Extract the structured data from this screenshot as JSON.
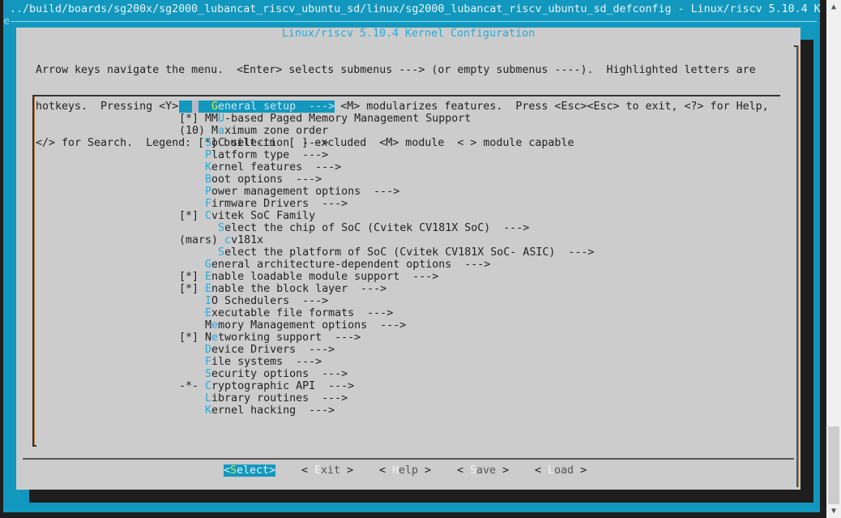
{
  "terminal": {
    "title_line": "../build/boards/sg200x/sg2000_lubancat_riscv_ubuntu_sd/linux/sg2000_lubancat_riscv_ubuntu_sd_defconfig - Linux/riscv 5.10.4 K",
    "second_line_char": "e"
  },
  "dialog": {
    "title": "Linux/riscv 5.10.4 Kernel Configuration",
    "help_lines": [
      "Arrow keys navigate the menu.  <Enter> selects submenus ---> (or empty submenus ----).  Highlighted letters are",
      "hotkeys.  Pressing <Y> includes, <N> excludes, <M> modularizes features.  Press <Esc><Esc> to exit, <?> for Help,",
      "</> for Search.  Legend: [*] built-in  [ ] excluded  <M> module  < > module capable"
    ]
  },
  "menu": {
    "items": [
      {
        "prefix": "    ",
        "hotkey": "G",
        "rest": "eneral setup  --->",
        "selected": true
      },
      {
        "prefix": "[*] ",
        "pre": "MM",
        "hotkey": "U",
        "rest": "-based Paged Memory Management Support"
      },
      {
        "prefix": "(10) ",
        "pre": "M",
        "hotkey": "a",
        "rest": "ximum zone order"
      },
      {
        "prefix": "    ",
        "hotkey": "S",
        "rest": "oC selection  --->"
      },
      {
        "prefix": "    ",
        "hotkey": "P",
        "rest": "latform type  --->"
      },
      {
        "prefix": "    ",
        "hotkey": "K",
        "rest": "ernel features  --->"
      },
      {
        "prefix": "    ",
        "hotkey": "B",
        "rest": "oot options  --->"
      },
      {
        "prefix": "    ",
        "hotkey": "P",
        "rest": "ower management options  --->"
      },
      {
        "prefix": "    ",
        "hotkey": "F",
        "rest": "irmware Drivers  --->"
      },
      {
        "prefix": "[*] ",
        "hotkey": "C",
        "rest": "vitek SoC Family"
      },
      {
        "prefix": "      ",
        "hotkey": "S",
        "rest": "elect the chip of SoC (Cvitek CV181X SoC)  --->"
      },
      {
        "prefix": "(mars) ",
        "hotkey": "c",
        "rest": "v181x"
      },
      {
        "prefix": "      ",
        "hotkey": "S",
        "rest": "elect the platform of SoC (Cvitek CV181X SoC- ASIC)  --->"
      },
      {
        "prefix": "    ",
        "hotkey": "G",
        "rest": "eneral architecture-dependent options  --->"
      },
      {
        "prefix": "[*] ",
        "hotkey": "E",
        "rest": "nable loadable module support  --->"
      },
      {
        "prefix": "[*] ",
        "hotkey": "E",
        "rest": "nable the block layer  --->"
      },
      {
        "prefix": "    ",
        "hotkey": "I",
        "rest": "O Schedulers  --->"
      },
      {
        "prefix": "    ",
        "hotkey": "E",
        "rest": "xecutable file formats  --->"
      },
      {
        "prefix": "    ",
        "pre": "M",
        "hotkey": "e",
        "rest": "mory Management options  --->"
      },
      {
        "prefix": "[*] ",
        "pre": "N",
        "hotkey": "e",
        "rest": "tworking support  --->"
      },
      {
        "prefix": "    ",
        "hotkey": "D",
        "rest": "evice Drivers  --->"
      },
      {
        "prefix": "    ",
        "hotkey": "F",
        "rest": "ile systems  --->"
      },
      {
        "prefix": "    ",
        "hotkey": "S",
        "rest": "ecurity options  --->"
      },
      {
        "prefix": "-*- ",
        "hotkey": "C",
        "rest": "ryptographic API  --->"
      },
      {
        "prefix": "    ",
        "hotkey": "L",
        "rest": "ibrary routines  --->"
      },
      {
        "prefix": "    ",
        "hotkey": "K",
        "rest": "ernel hacking  --->"
      }
    ]
  },
  "buttons": [
    {
      "open": "<",
      "hotkey": "S",
      "rest": "elect",
      "close": ">",
      "active": true
    },
    {
      "open": "< ",
      "hotkey": "E",
      "rest": "xit",
      "close": " >"
    },
    {
      "open": "< ",
      "hotkey": "H",
      "rest": "elp",
      "close": " >"
    },
    {
      "open": "< ",
      "hotkey": "S",
      "rest": "ave",
      "close": " >"
    },
    {
      "open": "< ",
      "hotkey": "L",
      "rest": "oad",
      "close": " >"
    }
  ],
  "scrollbar": {
    "up_icon": "▲",
    "down_icon": "▼",
    "position_fraction": 0.83
  },
  "colors": {
    "terminal_blue": "#1297be",
    "dialog_gray": "#cccccc",
    "hotkey_blue": "#2aa8d8",
    "selected_hotkey": "#c8f040"
  }
}
